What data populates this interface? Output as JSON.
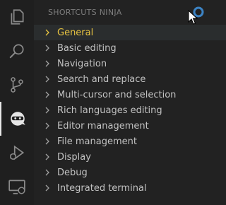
{
  "sidebar": {
    "title": "SHORTCUTS NINJA",
    "items": [
      {
        "label": "General",
        "focused": true
      },
      {
        "label": "Basic editing"
      },
      {
        "label": "Navigation"
      },
      {
        "label": "Search and replace"
      },
      {
        "label": "Multi-cursor and selection"
      },
      {
        "label": "Rich languages editing"
      },
      {
        "label": "Editor management"
      },
      {
        "label": "File management"
      },
      {
        "label": "Display"
      },
      {
        "label": "Debug"
      },
      {
        "label": "Integrated terminal"
      }
    ]
  },
  "activity_bar": {
    "items": [
      {
        "icon": "files-icon"
      },
      {
        "icon": "search-icon"
      },
      {
        "icon": "source-control-icon"
      },
      {
        "icon": "ninja-icon",
        "active": true
      },
      {
        "icon": "run-debug-icon"
      },
      {
        "icon": "remote-explorer-icon"
      }
    ]
  },
  "colors": {
    "focused_text": "#e8c442",
    "text": "#c2c2c2",
    "background": "#222222",
    "accent_loading": "#3c83c4"
  }
}
